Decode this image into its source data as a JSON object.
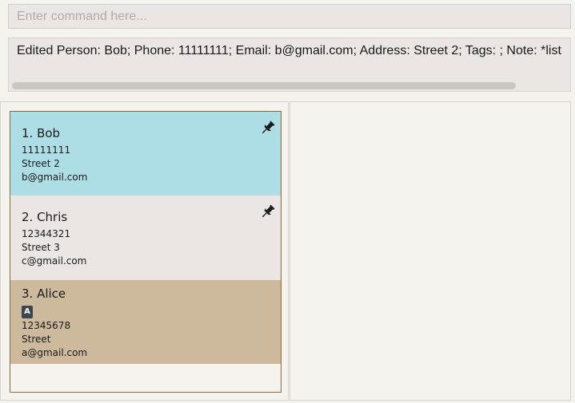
{
  "command_box": {
    "placeholder": "Enter command here..."
  },
  "result_display": {
    "text": "Edited Person: Bob; Phone: 11111111; Email: b@gmail.com; Address: Street 2; Tags: ; Note: *list"
  },
  "persons": [
    {
      "index_name": "1. Bob",
      "tags": [],
      "phone": "11111111",
      "address": "Street 2",
      "email": "b@gmail.com",
      "pinned": true,
      "color": "#aedee5"
    },
    {
      "index_name": "2. Chris",
      "tags": [],
      "phone": "12344321",
      "address": "Street 3",
      "email": "c@gmail.com",
      "pinned": true,
      "color": "#ebe6e3"
    },
    {
      "index_name": "3. Alice",
      "tags": [
        "A"
      ],
      "phone": "12345678",
      "address": "Street",
      "email": "a@gmail.com",
      "pinned": false,
      "color": "#cdba9c"
    }
  ],
  "icons": {
    "pin": "pushpin-icon"
  }
}
